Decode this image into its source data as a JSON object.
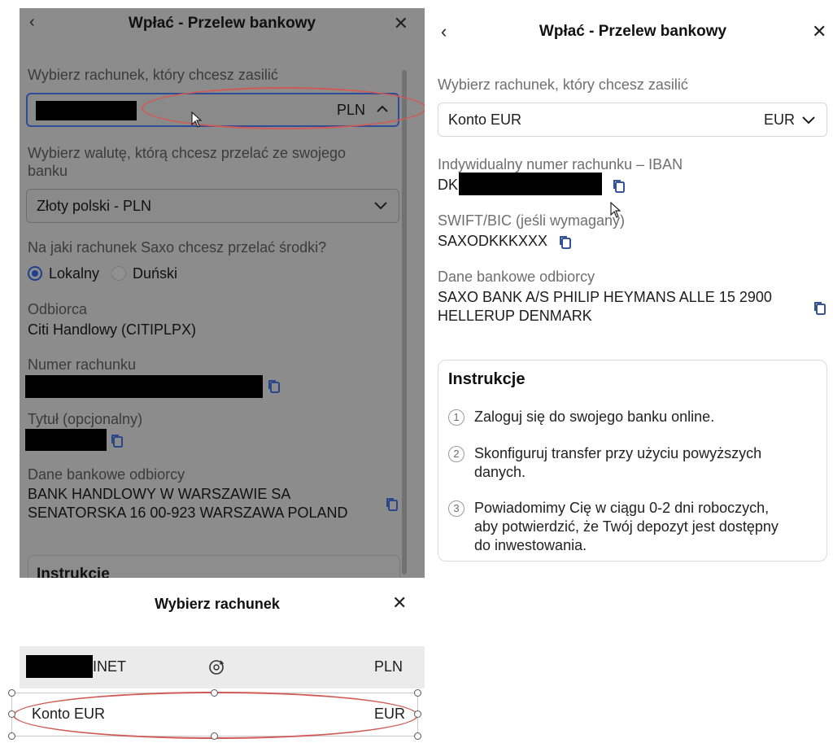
{
  "left_panel": {
    "title": "Wpłać - Przelew bankowy",
    "back_icon": "chevron-left-icon",
    "close_icon": "close-icon",
    "account_label": "Wybierz rachunek, który chcesz zasilić",
    "account_currency": "PLN",
    "currency_label_line1": "Wybierz walutę, którą chcesz przelać ze swojego",
    "currency_label_line2": "banku",
    "currency_value": "Złoty polski - PLN",
    "saxo_account_question": "Na jaki rachunek Saxo chcesz przelać środki?",
    "radio_local": "Lokalny",
    "radio_danish": "Duński",
    "recipient_label": "Odbiorca",
    "recipient_value": "Citi Handlowy (CITIPLPX)",
    "account_number_label": "Numer rachunku",
    "title_label": "Tytuł (opcjonalny)",
    "bank_details_label": "Dane bankowe odbiorcy",
    "bank_details_line1": "BANK HANDLOWY W WARSZAWIE SA",
    "bank_details_line2": "SENATORSKA 16 00-923 WARSZAWA POLAND",
    "instructions_heading": "Instrukcje"
  },
  "bottom_sheet": {
    "title": "Wybierz rachunek",
    "items": [
      {
        "name_suffix": "INET",
        "currency": "PLN"
      },
      {
        "name": "Konto EUR",
        "currency": "EUR"
      }
    ]
  },
  "right_panel": {
    "title": "Wpłać - Przelew bankowy",
    "account_label": "Wybierz rachunek, który chcesz zasilić",
    "account_value": "Konto EUR",
    "account_currency": "EUR",
    "iban_label": "Indywidualny numer rachunku – IBAN",
    "iban_prefix": "DK",
    "swift_label": "SWIFT/BIC (jeśli wymagany)",
    "swift_value": "SAXODKKKXXX",
    "bank_details_label": "Dane bankowe odbiorcy",
    "bank_details_line1": "SAXO BANK A/S PHILIP HEYMANS ALLE 15 2900",
    "bank_details_line2": "HELLERUP DENMARK",
    "instructions": {
      "heading": "Instrukcje",
      "steps": [
        {
          "num": "1",
          "lines": [
            "Zaloguj się do swojego banku online."
          ]
        },
        {
          "num": "2",
          "lines": [
            "Skonfiguruj transfer przy użyciu powyższych",
            "danych."
          ]
        },
        {
          "num": "3",
          "lines": [
            "Powiadomimy Cię w ciągu 0-2 dni roboczych,",
            "aby potwierdzić, że Twój depozyt jest dostępny",
            "do inwestowania."
          ]
        }
      ]
    }
  },
  "colors": {
    "accent": "#1f3f8a",
    "annotation": "#d05b56",
    "overlay": "#8c8c8c"
  }
}
